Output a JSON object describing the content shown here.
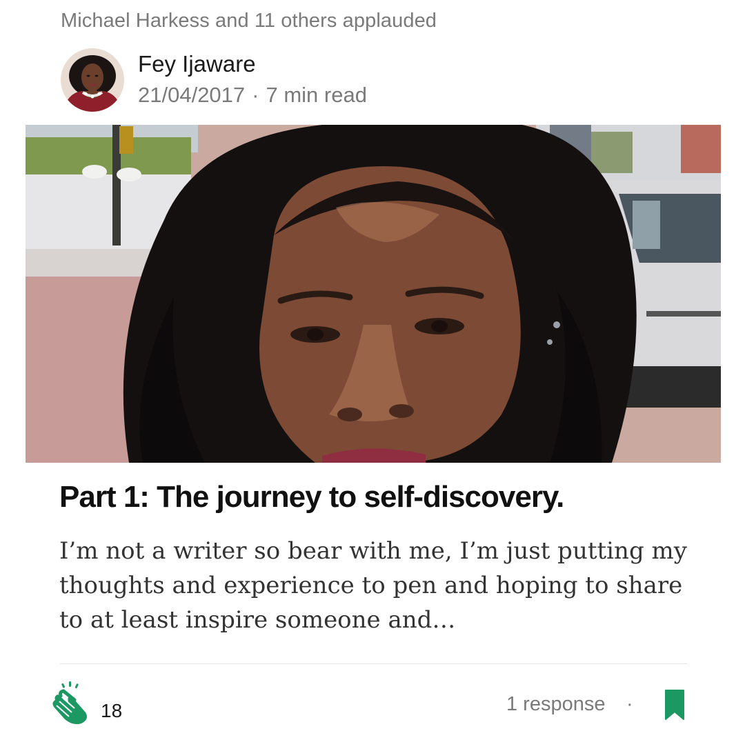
{
  "activity": {
    "applauded_by": "Michael Harkess and 11 others applauded"
  },
  "author": {
    "name": "Fey Ijaware",
    "date": "21/04/2017",
    "separator": "·",
    "read_time": "7 min read"
  },
  "post": {
    "title": "Part 1: The journey to self-discovery.",
    "excerpt": "I’m not a writer so bear with me, I’m just putting my thoughts and experience to pen and hoping to share to at least inspire someone and…"
  },
  "footer": {
    "clap_count": "18",
    "responses": "1 response",
    "separator": "·",
    "clap_icon": "clap-icon",
    "bookmark_icon": "bookmark-icon"
  },
  "colors": {
    "accent": "#1c9963",
    "text_primary": "#1a1a1a",
    "text_muted": "#7a7a7a"
  }
}
